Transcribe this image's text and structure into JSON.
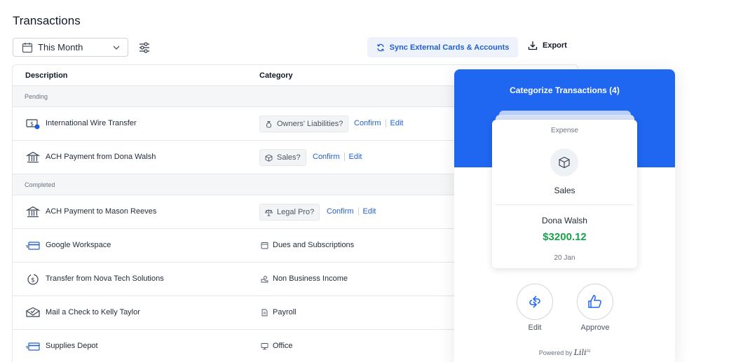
{
  "header": {
    "title": "Transactions",
    "date_filter": "This Month",
    "sync_label": "Sync External Cards & Accounts",
    "export_label": "Export"
  },
  "table": {
    "columns": [
      "Description",
      "Category"
    ],
    "sections": [
      {
        "name": "Pending",
        "rows": [
          {
            "icon": "wire-transfer-icon",
            "description": "International Wire Transfer",
            "category": "Owners' Liabilities?",
            "category_icon": "money-bag-icon",
            "pending": true
          },
          {
            "icon": "bank-icon",
            "description": "ACH Payment from Dona Walsh",
            "category": "Sales?",
            "category_icon": "box-icon",
            "pending": true
          }
        ]
      },
      {
        "name": "Completed",
        "rows": [
          {
            "icon": "bank-icon",
            "description": "ACH Payment to Mason Reeves",
            "category": "Legal Pro?",
            "category_icon": "scale-icon",
            "pending": true
          },
          {
            "icon": "card-icon",
            "description": "Google Workspace",
            "category": "Dues and Subscriptions",
            "category_icon": "calendar-icon",
            "pending": false
          },
          {
            "icon": "dollar-cycle-icon",
            "description": "Transfer from Nova Tech Solutions",
            "category": "Non Business Income",
            "category_icon": "hand-coin-icon",
            "pending": false
          },
          {
            "icon": "envelope-check-icon",
            "description": "Mail a Check to Kelly Taylor",
            "category": "Payroll",
            "category_icon": "document-icon",
            "pending": false
          },
          {
            "icon": "card-icon",
            "description": "Supplies Depot",
            "category": "Office",
            "category_icon": "monitor-icon",
            "pending": false
          }
        ]
      }
    ],
    "confirm_label": "Confirm",
    "edit_label": "Edit"
  },
  "panel": {
    "title": "Categorize Transactions (4)",
    "card": {
      "kind": "Expense",
      "category": "Sales",
      "payee": "Dona Walsh",
      "amount": "$3200.12",
      "date": "20 Jan"
    },
    "edit_label": "Edit",
    "approve_label": "Approve",
    "powered_prefix": "Powered by",
    "powered_brand": "Lili",
    "powered_suffix": "AI"
  },
  "colors": {
    "accent": "#1f66f0",
    "link": "#1f5fd6",
    "amount": "#16a34a"
  }
}
